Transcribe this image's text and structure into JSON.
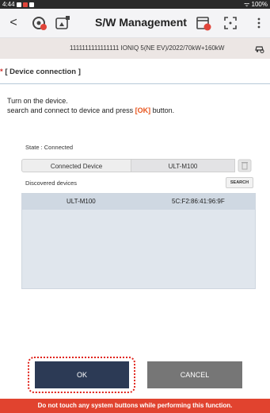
{
  "statusbar": {
    "time": "4:44",
    "battery": "100%"
  },
  "header": {
    "title": "S/W Management",
    "back_label": "<"
  },
  "vehicle": {
    "text": "1111111111111111 IONIQ 5(NE EV)/2022/70kW+160kW"
  },
  "section": {
    "star": "*",
    "title": "[ Device connection ]"
  },
  "instructions": {
    "line1": "Turn on the device.",
    "line2_prefix": "search and connect to device and press ",
    "ok_word": "[OK]",
    "line2_suffix": " button."
  },
  "state": {
    "text": "State : Connected"
  },
  "tabs": {
    "connected_label": "Connected Device",
    "device_label": "ULT-M100"
  },
  "discovered": {
    "label": "Discovered devices",
    "search_label": "SEARCH"
  },
  "devices": [
    {
      "name": "ULT-M100",
      "mac": "5C:F2:86:41:96:9F"
    }
  ],
  "buttons": {
    "ok": "OK",
    "cancel": "CANCEL"
  },
  "warning": {
    "text": "Do not touch any system buttons while performing this function."
  },
  "colors": {
    "ok_button": "#2c3a55",
    "cancel_button": "#767676",
    "warning_bar": "#e1432f",
    "accent": "#e8541c"
  }
}
